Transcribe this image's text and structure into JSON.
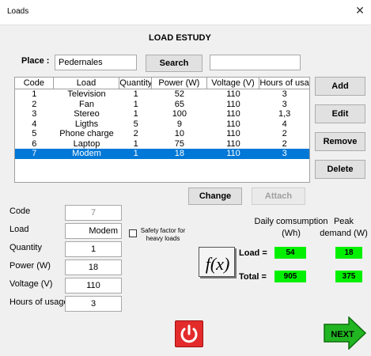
{
  "window": {
    "title": "Loads",
    "close_glyph": "✕"
  },
  "heading": "LOAD ESTUDY",
  "place": {
    "label": "Place :",
    "value": "Pedernales"
  },
  "search": {
    "button_label": "Search",
    "input_value": ""
  },
  "table": {
    "columns": [
      "Code",
      "Load",
      "Quantity",
      "Power (W)",
      "Voltage (V)",
      "Hours of usage"
    ],
    "rows": [
      [
        "1",
        "Television",
        "1",
        "52",
        "110",
        "3"
      ],
      [
        "2",
        "Fan",
        "1",
        "65",
        "110",
        "3"
      ],
      [
        "3",
        "Stereo",
        "1",
        "100",
        "110",
        "1,3"
      ],
      [
        "4",
        "Ligths",
        "5",
        "9",
        "110",
        "4"
      ],
      [
        "5",
        "Phone charge",
        "2",
        "10",
        "110",
        "2"
      ],
      [
        "6",
        "Laptop",
        "1",
        "75",
        "110",
        "2"
      ],
      [
        "7",
        "Modem",
        "1",
        "18",
        "110",
        "3"
      ]
    ],
    "selected_row_index": 6
  },
  "side_buttons": {
    "add": "Add",
    "edit": "Edit",
    "remove": "Remove",
    "delete": "Delete"
  },
  "actions": {
    "change": "Change",
    "attach": "Attach"
  },
  "form": {
    "code": {
      "label": "Code",
      "value": "7"
    },
    "load": {
      "label": "Load",
      "value": "Modem"
    },
    "quantity": {
      "label": "Quantity",
      "value": "1"
    },
    "power": {
      "label": "Power (W)",
      "value": "18"
    },
    "voltage": {
      "label": "Voltage (V)",
      "value": "110"
    },
    "hours": {
      "label": "Hours of usage",
      "value": "3"
    }
  },
  "safety_factor": {
    "label_line1": "Safety factor for",
    "label_line2": "heavy loads",
    "checked": false
  },
  "results": {
    "daily_header_line1": "Daily comsumption",
    "daily_header_line2": "(Wh)",
    "peak_header_line1": "Peak",
    "peak_header_line2": "demand (W)",
    "load_label": "Load =",
    "total_label": "Total =",
    "load_daily": "54",
    "load_peak": "18",
    "total_daily": "905",
    "total_peak": "375"
  },
  "fx_icon": {
    "name": "function-icon",
    "text": "f(x)"
  },
  "power_icon": {
    "name": "power-icon"
  },
  "next_button": {
    "label": "NEXT"
  },
  "colors": {
    "selection": "#0078d7",
    "result_green": "#00f000",
    "power_red": "#e32b2b",
    "next_green": "#22b522"
  }
}
